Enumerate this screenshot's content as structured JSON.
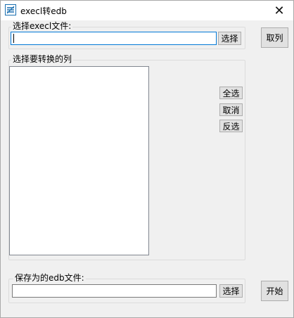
{
  "window": {
    "title": "execl转edb",
    "close_glyph": "✕"
  },
  "source_group": {
    "label": "选择execl文件:",
    "path_value": "",
    "browse_label": "选择"
  },
  "fetch_button_label": "取列",
  "columns_group": {
    "label": "选择要转换的列",
    "items": [],
    "select_all_label": "全选",
    "cancel_label": "取消",
    "invert_label": "反选"
  },
  "target_group": {
    "label": "保存为的edb文件:",
    "path_value": "",
    "browse_label": "选择"
  },
  "start_button_label": "开始",
  "colors": {
    "window_bg": "#f0f0f0",
    "focus_border": "#0078d7",
    "button_bg": "#e1e1e1"
  }
}
